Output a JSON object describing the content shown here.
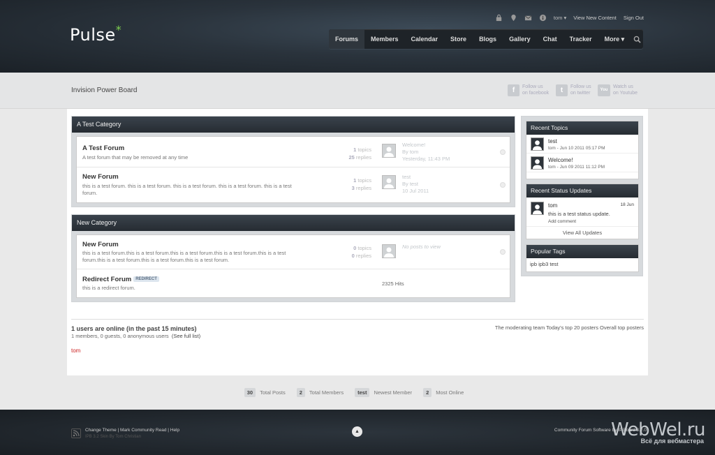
{
  "header": {
    "logo": "Pulse",
    "logo_star": "*",
    "user": "tom ▾",
    "view_new": "View New Content",
    "sign_out": "Sign Out",
    "nav": [
      "Forums",
      "Members",
      "Calendar",
      "Store",
      "Blogs",
      "Gallery",
      "Chat",
      "Tracker",
      "More ▾"
    ]
  },
  "board": {
    "title": "Invision Power Board",
    "social": [
      {
        "glyph": "f",
        "line1": "Follow us",
        "line2": "on facebook"
      },
      {
        "glyph": "t",
        "line1": "Follow us",
        "line2": "on twitter"
      },
      {
        "glyph": "You",
        "line1": "Watch us",
        "line2": "on Youtube"
      }
    ]
  },
  "categories": [
    {
      "name": "A Test Category",
      "forums": [
        {
          "title": "A Test Forum",
          "desc": "A test forum that may be removed at any time",
          "topics": "1",
          "topics_label": "topics",
          "replies": "25",
          "replies_label": "replies",
          "last_title": "Welcome!",
          "last_by": "By tom",
          "last_date": "Yesterday, 11:43 PM"
        },
        {
          "title": "New Forum",
          "desc": "this is a test forum. this is a test forum. this is a test forum. this is a test forum. this is a test forum.",
          "topics": "1",
          "topics_label": "topics",
          "replies": "3",
          "replies_label": "replies",
          "last_title": "test",
          "last_by": "By test",
          "last_date": "10 Jul 2011"
        }
      ]
    },
    {
      "name": "New Category",
      "forums": [
        {
          "title": "New Forum",
          "desc": "this is a test forum.this is a test forum.this is a test forum.this is a test forum.this is a test forum.this is a test forum.this is a test forum.this is a test forum.",
          "topics": "0",
          "topics_label": "topics",
          "replies": "0",
          "replies_label": "replies",
          "last_title": "No posts to view"
        },
        {
          "title": "Redirect Forum",
          "badge": "REDIRECT",
          "desc": "this is a redirect forum.",
          "hits": "2325 Hits"
        }
      ]
    }
  ],
  "sidebar": {
    "recent_topics": {
      "title": "Recent Topics",
      "items": [
        {
          "title": "test",
          "meta": "tom - Jun 10 2011 05:17 PM"
        },
        {
          "title": "Welcome!",
          "meta": "tom - Jun 09 2011 11:12 PM"
        }
      ]
    },
    "status": {
      "title": "Recent Status Updates",
      "user": "tom",
      "date": "18 Jun",
      "text": "this is a test status update.",
      "add_comment": "Add comment",
      "view_all": "View All Updates"
    },
    "tags": {
      "title": "Popular Tags",
      "items": "ipb ipb3 test"
    }
  },
  "online": {
    "heading": "1 users are online (in the past 15 minutes)",
    "detail": "1 members, 0 guests, 0 anonymous users",
    "full_list": "(See full list)",
    "links": "The moderating team Today's top 20 posters Overall top posters",
    "user": "tom"
  },
  "stats": [
    {
      "value": "30",
      "label": "Total Posts"
    },
    {
      "value": "2",
      "label": "Total Members"
    },
    {
      "value": "test",
      "label": "Newest Member"
    },
    {
      "value": "2",
      "label": "Most Online"
    }
  ],
  "footer": {
    "links": "Change Theme | Mark Community Read | Help",
    "sub": "IPB 3.2 Skin By Tom Christian",
    "right": "Community Forum Software by IP.Board 3.2.0",
    "watermark": "WebWel.ru",
    "watermark_sub": "Всё для вебмастера"
  },
  "colors": {
    "accent_green": "#7fd14f",
    "online_user": "#cc2222",
    "header_dark": "#2a333c"
  }
}
